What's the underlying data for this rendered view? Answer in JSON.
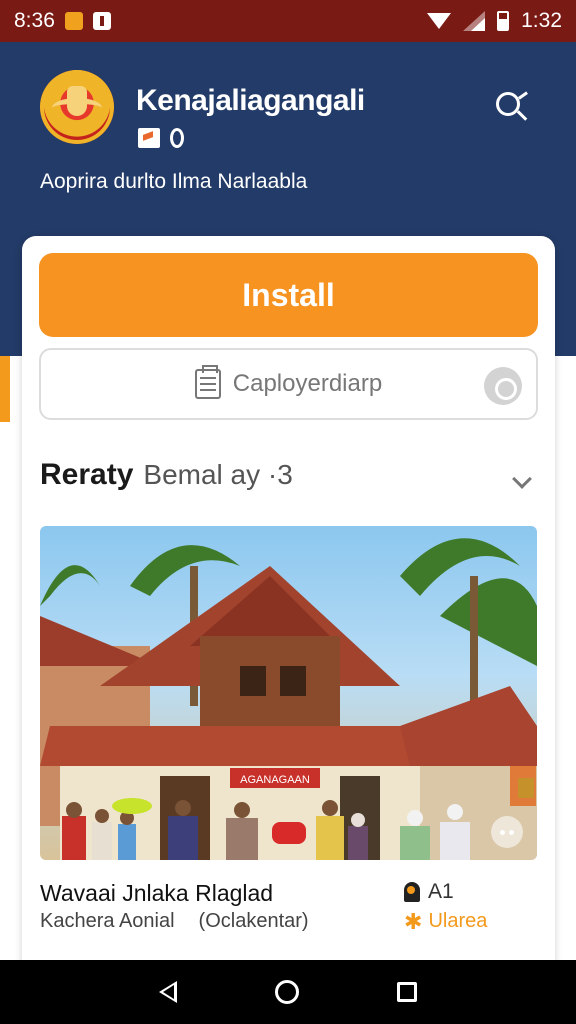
{
  "status_bar": {
    "left_time": "8:36",
    "right_time": "1:32",
    "icons": [
      "orange-notification-icon",
      "white-notification-icon",
      "wifi-icon",
      "signal-icon",
      "battery-icon"
    ]
  },
  "header": {
    "app_name": "Kenajaliagangali",
    "subtitle": "Aoprira durlto Ilma Narlaabla",
    "background_color": "#233b68",
    "icons": [
      "emblem-logo",
      "search-icon"
    ]
  },
  "actions": {
    "install_label": "Install",
    "install_color": "#f79321",
    "secondary_label": "Caployerdiarp"
  },
  "section": {
    "title": "Reraty",
    "subtitle": "Bemal ay ·3"
  },
  "listing": {
    "title": "Wavaai Jnlaka Rlaglad",
    "name": "Kachera Aonial",
    "region": "(Oclakentar)",
    "rating": "A1",
    "location": "Ularea",
    "sign_text": "AGANAGAAN"
  },
  "colors": {
    "status_bar": "#7a1a14",
    "accent": "#f39a1d"
  }
}
